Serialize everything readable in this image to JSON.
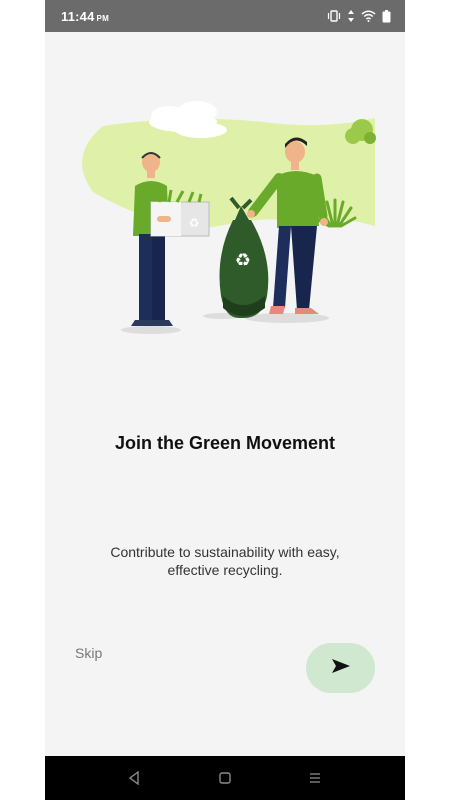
{
  "status_bar": {
    "time": "11:44",
    "ampm": "PM",
    "icons": [
      "vibrate-icon",
      "data-arrows-icon",
      "wifi-icon",
      "battery-icon"
    ]
  },
  "onboarding": {
    "illustration": "recycling-people-illustration",
    "title": "Join the Green Movement",
    "subtitle": "Contribute to sustainability with easy, effective recycling.",
    "skip_label": "Skip",
    "next_icon": "send-arrow-icon"
  },
  "nav_bar": {
    "buttons": [
      "back-icon",
      "home-icon",
      "recents-icon"
    ]
  },
  "colors": {
    "background": "#f4f4f4",
    "accent_button": "#cfe8cf",
    "illustration_green": "#dff0a8",
    "status_bar": "#6b6b6b",
    "nav_bar": "#000000"
  }
}
